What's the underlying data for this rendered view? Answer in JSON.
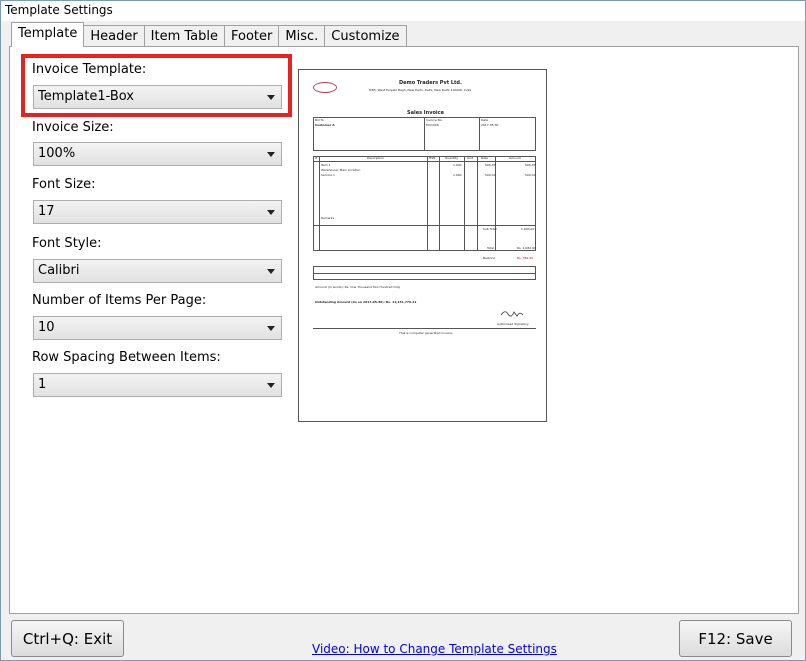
{
  "window": {
    "title": "Template Settings"
  },
  "tabs": [
    "Template",
    "Header",
    "Item Table",
    "Footer",
    "Misc.",
    "Customize"
  ],
  "fields": {
    "invoice_template": {
      "label": "Invoice Template:",
      "value": "Template1-Box"
    },
    "invoice_size": {
      "label": "Invoice Size:",
      "value": "100%"
    },
    "font_size": {
      "label": "Font Size:",
      "value": "17"
    },
    "font_style": {
      "label": "Font Style:",
      "value": "Calibri"
    },
    "items_per_page": {
      "label": "Number of Items Per Page:",
      "value": "10"
    },
    "row_spacing": {
      "label": "Row Spacing Between Items:",
      "value": "1"
    }
  },
  "preview": {
    "company": "Demo Traders Pvt Ltd.",
    "address": "8/85, West Punjabi Bagh, New Delhi, Delhi, New Delhi 110006, India",
    "heading": "Sales Invoice",
    "bill_to": "Bill To",
    "customer": "Customer A",
    "invoice_no_label": "Invoice No.",
    "invoice_no": "EX/1006",
    "date_label": "Date",
    "date": "2017-05-30",
    "col_no": "#",
    "col_desc": "Description",
    "col_hsn": "HSN",
    "col_qty": "Quantity",
    "col_unit": "Unit",
    "col_rate": "Rate",
    "col_amount": "Amount",
    "item1": "Item 1",
    "item1_sub": "Warehouse: Main Location",
    "item2": "Service 1",
    "item1_qty": "1.000",
    "item1_rate": "500.00",
    "item1_amt": "500.00",
    "item2_qty": "1.000",
    "item2_rate": "500.00",
    "item2_amt": "500.00",
    "remarks": "Remarks",
    "sub_total_label": "Sub Total",
    "sub_total": "1,000.00",
    "total_label": "Total",
    "total": "Rs. 1,082.00",
    "balance_label": "Balance",
    "balance": "Rs. 782.00",
    "amount_words": "Amount (in words): Rs. One Thousand Two Hundred Only",
    "outstanding": "Outstanding Amount (As on 2017-05-30): Rs. 11,151,776.21",
    "signatory": "Authorised Signatory",
    "footer": "This is computer generated invoice."
  },
  "buttons": {
    "exit": "Ctrl+Q: Exit",
    "save": "F12: Save"
  },
  "link": {
    "label": "Video: How to Change Template Settings"
  },
  "colors": {
    "highlight": "#e8231f",
    "link": "#0000ee",
    "balance": "#c00000"
  }
}
